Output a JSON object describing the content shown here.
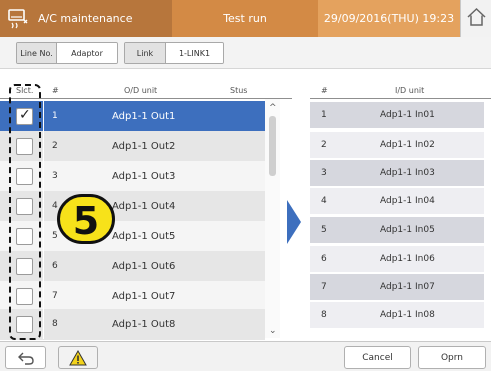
{
  "header": {
    "app_title": "A/C maintenance",
    "mode": "Test run",
    "datetime": "29/09/2016(THU) 19:23",
    "app_icon": "ac-unit-icon",
    "home_icon": "home-icon"
  },
  "filters": {
    "line_label": "Line No.",
    "line_value": "Adaptor",
    "link_label": "Link",
    "link_value": "1-LINK1"
  },
  "od_list": {
    "columns": {
      "select": "Slct.",
      "number": "#",
      "unit": "O/D unit",
      "status": "Stus"
    },
    "rows": [
      {
        "num": "1",
        "name": "Adp1-1 Out1",
        "checked": true,
        "selected": true
      },
      {
        "num": "2",
        "name": "Adp1-1 Out2",
        "checked": false
      },
      {
        "num": "3",
        "name": "Adp1-1 Out3",
        "checked": false
      },
      {
        "num": "4",
        "name": "Adp1-1 Out4",
        "checked": false
      },
      {
        "num": "5",
        "name": "Adp1-1 Out5",
        "checked": false
      },
      {
        "num": "6",
        "name": "Adp1-1 Out6",
        "checked": false
      },
      {
        "num": "7",
        "name": "Adp1-1 Out7",
        "checked": false
      },
      {
        "num": "8",
        "name": "Adp1-1 Out8",
        "checked": false
      }
    ]
  },
  "id_list": {
    "columns": {
      "number": "#",
      "unit": "I/D unit"
    },
    "rows": [
      {
        "num": "1",
        "name": "Adp1-1 In01"
      },
      {
        "num": "2",
        "name": "Adp1-1 In02"
      },
      {
        "num": "3",
        "name": "Adp1-1 In03"
      },
      {
        "num": "4",
        "name": "Adp1-1 In04"
      },
      {
        "num": "5",
        "name": "Adp1-1 In05"
      },
      {
        "num": "6",
        "name": "Adp1-1 In06"
      },
      {
        "num": "7",
        "name": "Adp1-1 In07"
      },
      {
        "num": "8",
        "name": "Adp1-1 In08"
      }
    ]
  },
  "step_badge": "5",
  "footer": {
    "back_icon": "back-arrow-icon",
    "warning_icon": "warning-icon",
    "cancel_label": "Cancel",
    "oprn_label": "Oprn"
  },
  "colors": {
    "header_dark": "#b7763c",
    "header_mid": "#d38a45",
    "header_light": "#e4a25e",
    "selection_blue": "#3d6fbe",
    "arrow_blue": "#3d6fbe",
    "badge_yellow": "#f7e21a"
  }
}
